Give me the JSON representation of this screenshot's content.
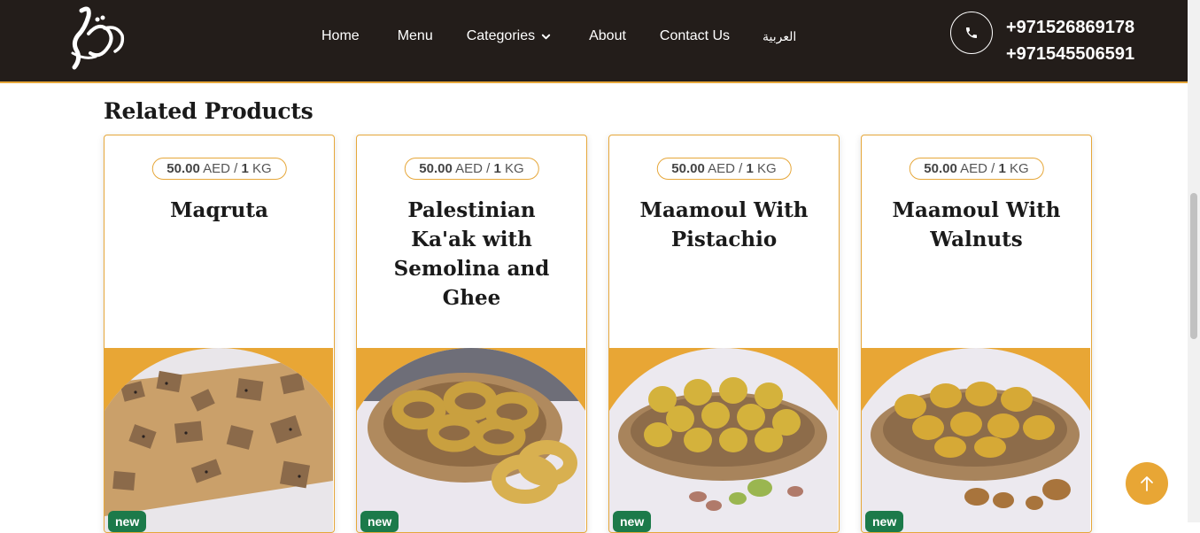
{
  "header": {
    "nav": {
      "home": "Home",
      "menu": "Menu",
      "categories": "Categories",
      "about": "About",
      "contact": "Contact Us",
      "arabic": "العربية"
    },
    "phones": [
      "+971526869178",
      "+971545506591"
    ]
  },
  "section": {
    "title": "Related Products"
  },
  "products": [
    {
      "price": "50.00",
      "currency": "AED",
      "sep": "/",
      "qty": "1",
      "unit": "KG",
      "name": "Maqruta",
      "badge": "new"
    },
    {
      "price": "50.00",
      "currency": "AED",
      "sep": "/",
      "qty": "1",
      "unit": "KG",
      "name": "Palestinian Ka'ak with Semolina and Ghee",
      "badge": "new"
    },
    {
      "price": "50.00",
      "currency": "AED",
      "sep": "/",
      "qty": "1",
      "unit": "KG",
      "name": "Maamoul With Pistachio",
      "badge": "new"
    },
    {
      "price": "50.00",
      "currency": "AED",
      "sep": "/",
      "qty": "1",
      "unit": "KG",
      "name": "Maamoul With Walnuts",
      "badge": "new"
    }
  ],
  "colors": {
    "header_bg": "#231d1a",
    "accent": "#e6a73a",
    "badge_green": "#1c7a4a"
  },
  "icons": {
    "phone": "phone-icon",
    "chevron": "chevron-down-icon",
    "back_to_top": "arrow-up-icon"
  }
}
